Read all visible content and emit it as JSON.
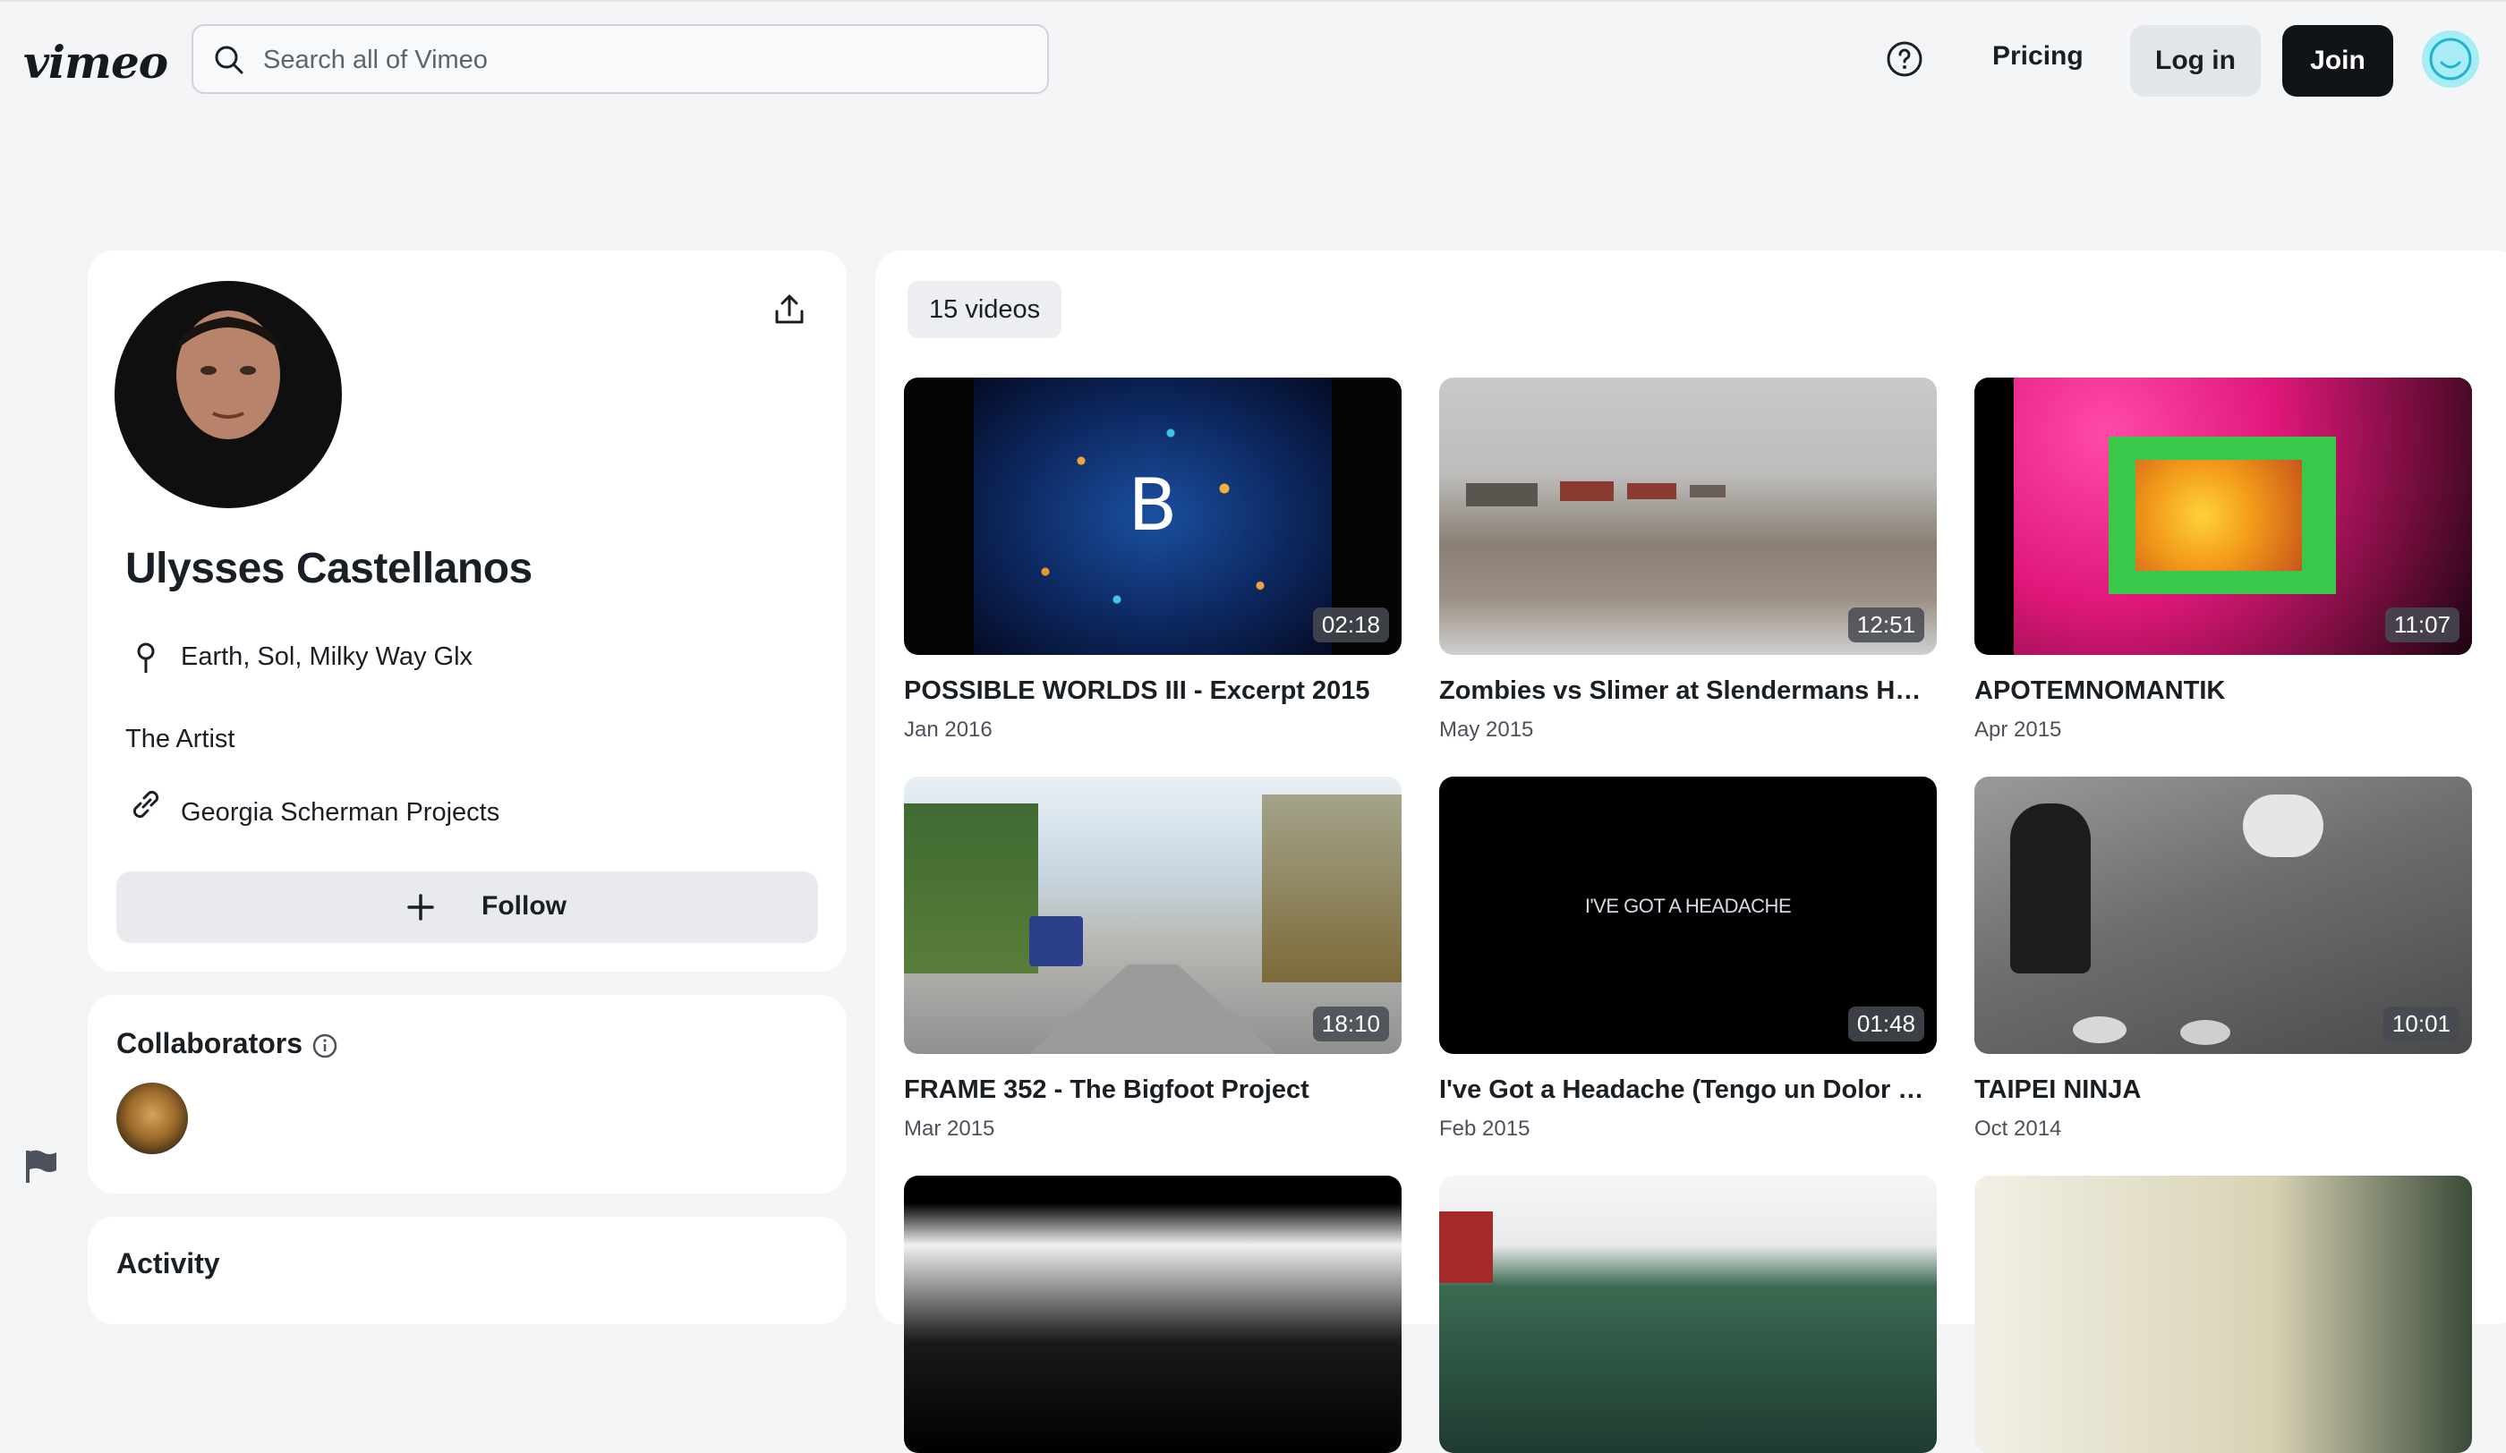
{
  "header": {
    "logo": "vimeo",
    "search_placeholder": "Search all of Vimeo",
    "pricing": "Pricing",
    "login": "Log in",
    "join": "Join"
  },
  "profile": {
    "name": "Ulysses Castellanos",
    "location": "Earth, Sol, Milky Way Glx",
    "bio": "The Artist",
    "link": "Georgia Scherman Projects",
    "follow": "Follow"
  },
  "collaborators": {
    "title": "Collaborators"
  },
  "activity": {
    "title": "Activity"
  },
  "videos": {
    "count": "15 videos",
    "items": [
      {
        "title": "POSSIBLE WORLDS III - Excerpt 2015",
        "date": "Jan 2016",
        "duration": "02:18",
        "overlay": "B"
      },
      {
        "title": "Zombies vs Slimer at Slendermans House ...",
        "date": "May 2015",
        "duration": "12:51"
      },
      {
        "title": "APOTEMNOMANTIK",
        "date": "Apr 2015",
        "duration": "11:07"
      },
      {
        "title": "FRAME 352 - The Bigfoot Project",
        "date": "Mar 2015",
        "duration": "18:10"
      },
      {
        "title": "I've Got a Headache (Tengo un Dolor de ...",
        "date": "Feb 2015",
        "duration": "01:48",
        "overlay": "I'VE GOT A HEADACHE"
      },
      {
        "title": "TAIPEI NINJA",
        "date": "Oct 2014",
        "duration": "10:01"
      }
    ]
  }
}
